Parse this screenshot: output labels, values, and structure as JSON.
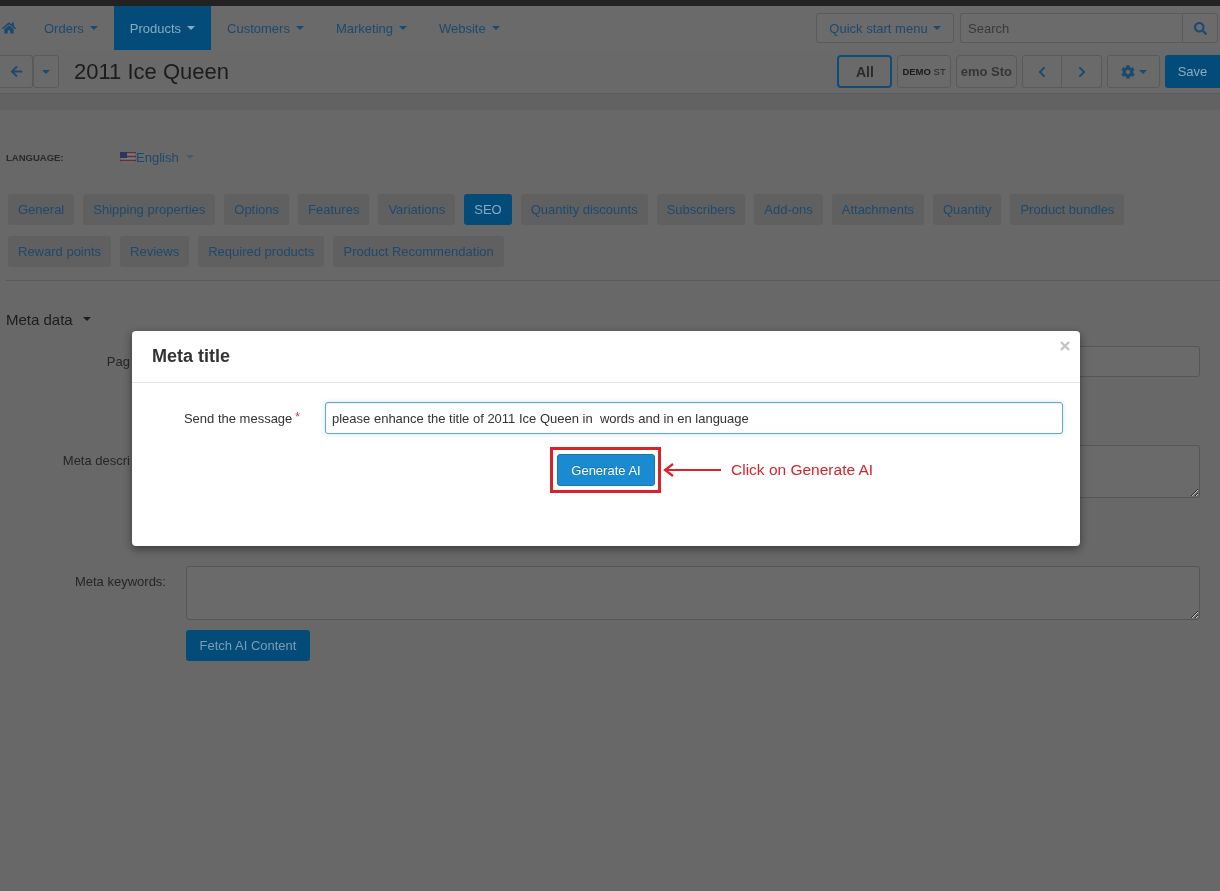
{
  "top_nav": {
    "items": [
      {
        "label": "Orders",
        "selected": false
      },
      {
        "label": "Products",
        "selected": true
      },
      {
        "label": "Customers",
        "selected": false
      },
      {
        "label": "Marketing",
        "selected": false
      },
      {
        "label": "Website",
        "selected": false
      }
    ],
    "quick_start": "Quick start menu",
    "search": {
      "placeholder": "Search"
    }
  },
  "toolbar": {
    "title": "2011 Ice Queen",
    "storefronts": [
      {
        "label": "All",
        "kind": "text",
        "selected": true
      },
      {
        "label": "**DEMO** ST",
        "kind": "small-logo",
        "selected": false
      },
      {
        "label": "emo Sto",
        "kind": "large-logo",
        "selected": false
      }
    ],
    "save": "Save"
  },
  "language": {
    "label": "LANGUAGE:",
    "value": "English"
  },
  "tabs": [
    {
      "label": "General",
      "selected": false
    },
    {
      "label": "Shipping properties",
      "selected": false
    },
    {
      "label": "Options",
      "selected": false
    },
    {
      "label": "Features",
      "selected": false
    },
    {
      "label": "Variations",
      "selected": false
    },
    {
      "label": "SEO",
      "selected": true
    },
    {
      "label": "Quantity discounts",
      "selected": false
    },
    {
      "label": "Subscribers",
      "selected": false
    },
    {
      "label": "Add-ons",
      "selected": false
    },
    {
      "label": "Attachments",
      "selected": false
    },
    {
      "label": "Quantity",
      "selected": false
    },
    {
      "label": "Product bundles",
      "selected": false
    },
    {
      "label": "Reward points",
      "selected": false
    },
    {
      "label": "Reviews",
      "selected": false
    },
    {
      "label": "Required products",
      "selected": false
    },
    {
      "label": "Product Recommendation",
      "selected": false
    }
  ],
  "section": {
    "title": "Meta data",
    "expanded": true
  },
  "fields": [
    {
      "label": "Pag",
      "kind": "input"
    },
    {
      "label": "Meta descri",
      "kind": "textarea"
    },
    {
      "label": "Meta keywords:",
      "kind": "textarea"
    }
  ],
  "fetch_button": "Fetch AI Content",
  "dialog": {
    "title": "Meta title",
    "field_label": "Send the message",
    "required_mark": "*",
    "value": "please enhance the title of 2011 Ice Queen in  words and in en language",
    "button": "Generate AI"
  },
  "annotation": {
    "text": "Click on Generate AI"
  }
}
